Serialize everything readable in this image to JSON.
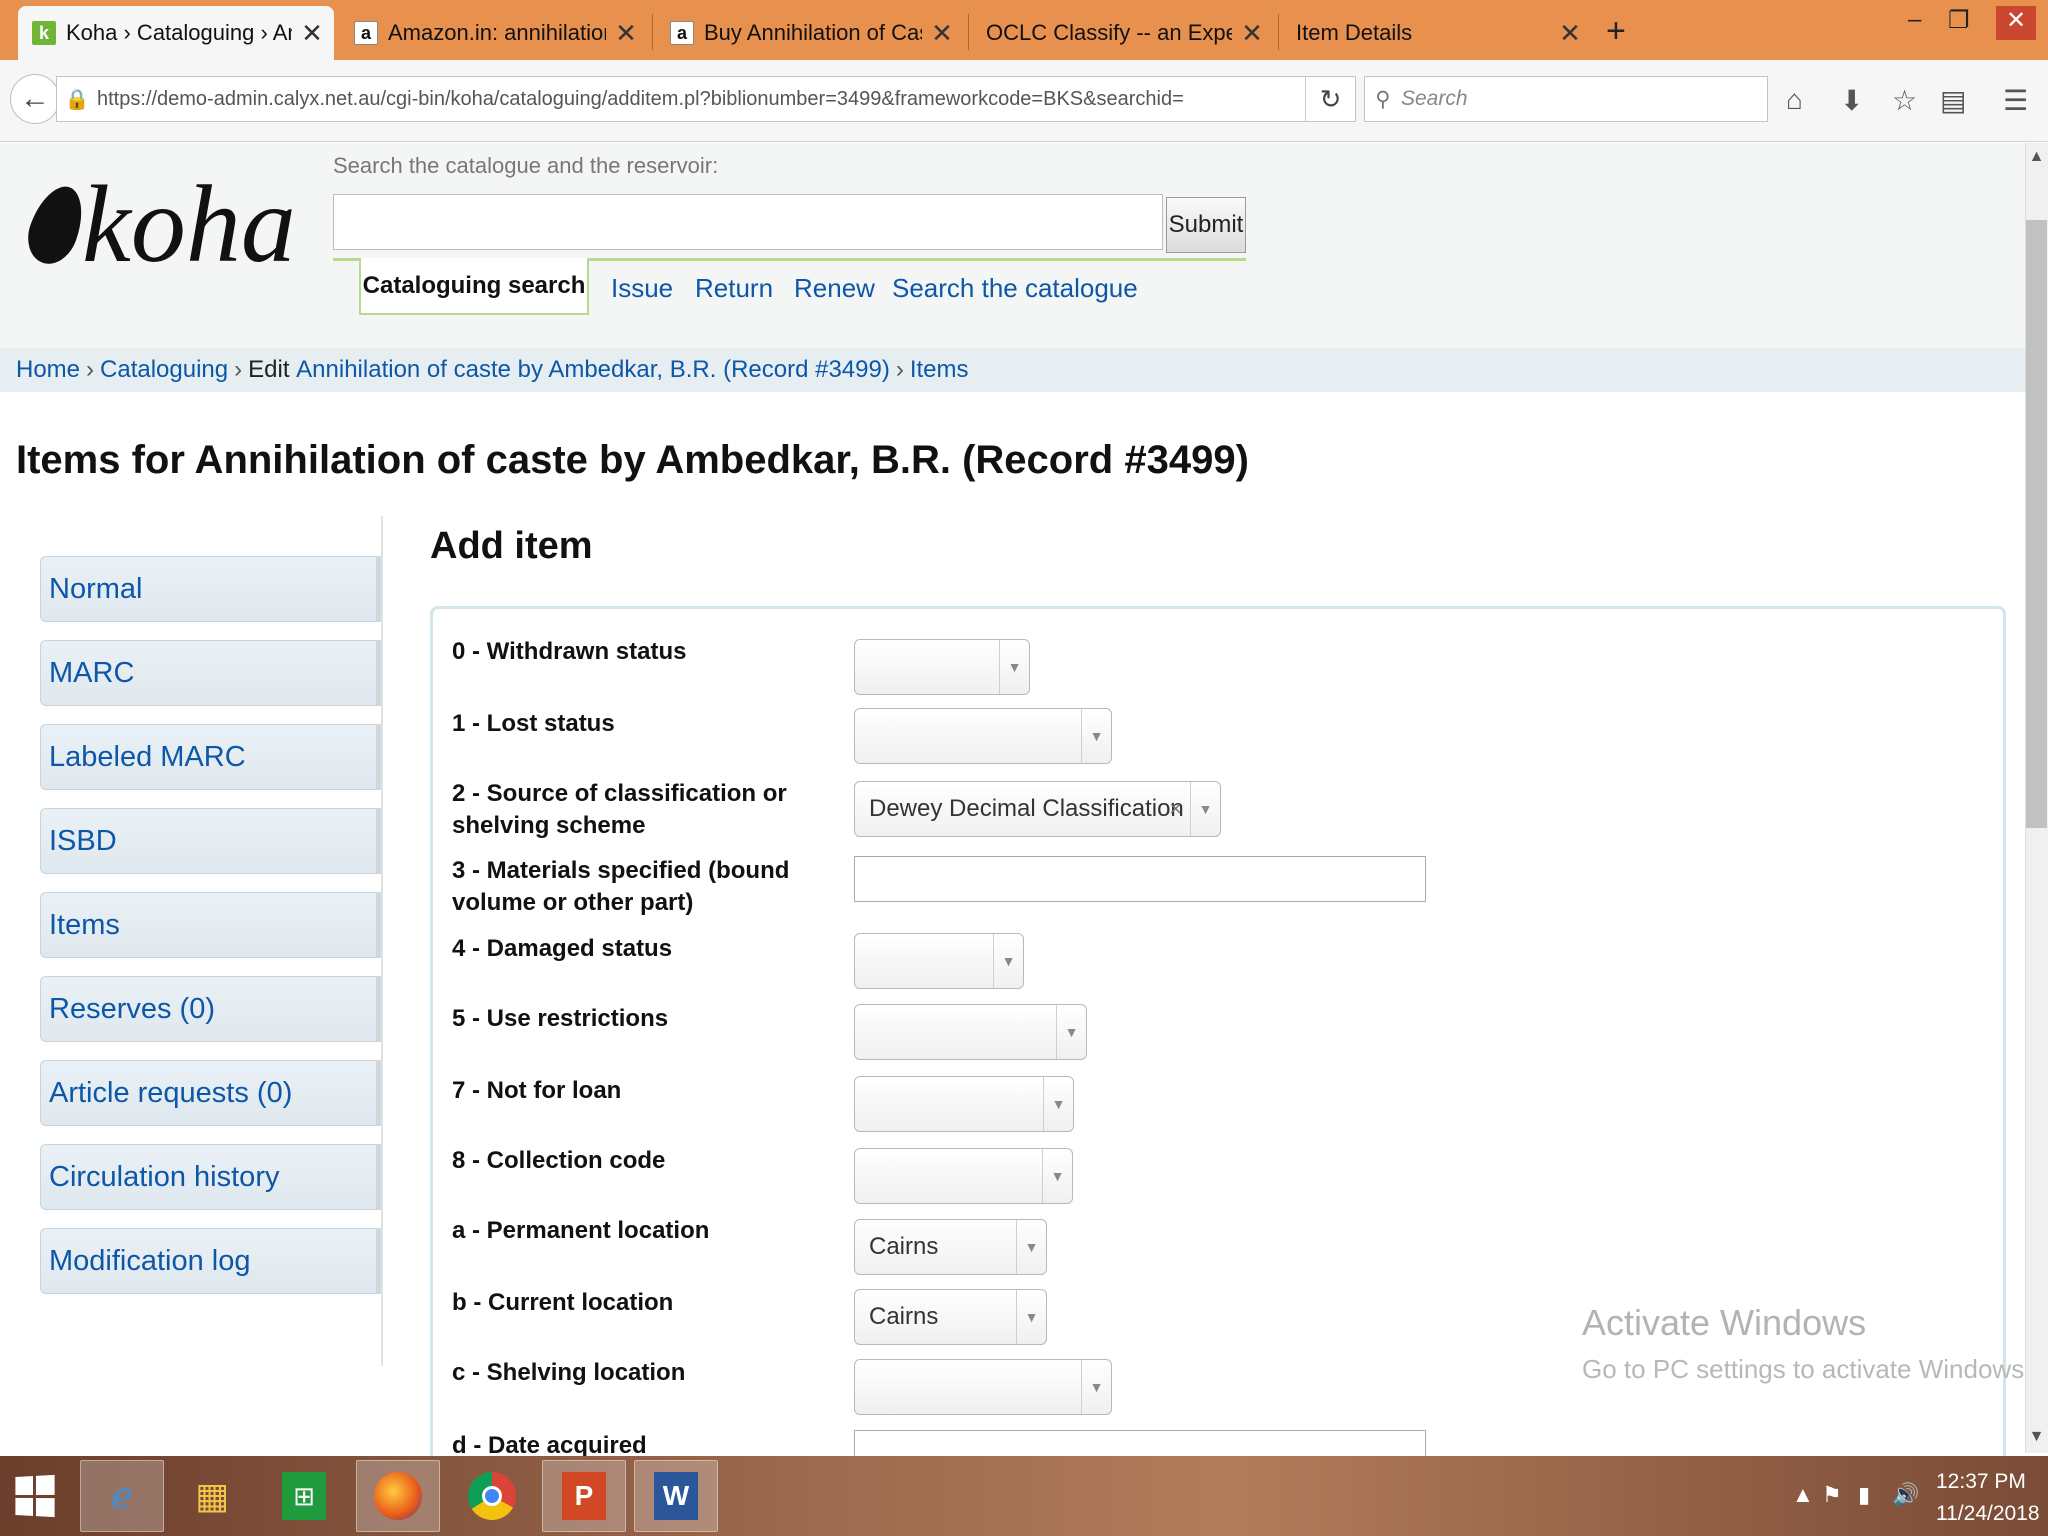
{
  "browser": {
    "tabs": [
      {
        "label": "Koha › Cataloguing › Anni...",
        "favicon": "koha-icon",
        "active": true
      },
      {
        "label": "Amazon.in: annihilation o...",
        "favicon": "amazon-icon"
      },
      {
        "label": "Buy Annihilation of Caste:...",
        "favicon": "amazon-icon"
      },
      {
        "label": "OCLC Classify -- an Experimen...",
        "favicon": ""
      },
      {
        "label": "Item Details",
        "favicon": ""
      }
    ],
    "url": "https://demo-admin.calyx.net.au/cgi-bin/koha/cataloguing/additem.pl?biblionumber=3499&frameworkcode=BKS&searchid=",
    "search_placeholder": "Search"
  },
  "header": {
    "logo_text": "koha",
    "search_label": "Search the catalogue and the reservoir:",
    "submit_label": "Submit",
    "active_tab": "Cataloguing search",
    "links": [
      "Issue",
      "Return",
      "Renew",
      "Search the catalogue"
    ]
  },
  "breadcrumb": {
    "home": "Home",
    "cataloguing": "Cataloguing",
    "edit_prefix": "Edit",
    "record": "Annihilation of caste by Ambedkar, B.R. (Record #3499)",
    "items": "Items",
    "sep": "›"
  },
  "page_title": "Items for Annihilation of caste by Ambedkar, B.R. (Record #3499)",
  "left_menu": [
    "Normal",
    "MARC",
    "Labeled MARC",
    "ISBD",
    "Items",
    "Reserves (0)",
    "Article requests (0)",
    "Circulation history",
    "Modification log"
  ],
  "add_item": {
    "heading": "Add item",
    "fields": [
      {
        "label": "0 - Withdrawn status",
        "value": ""
      },
      {
        "label": "1 - Lost status",
        "value": ""
      },
      {
        "label": "2 - Source of classification or shelving scheme",
        "value": "Dewey Decimal Classification"
      },
      {
        "label": "3 - Materials specified (bound volume or other part)",
        "value": ""
      },
      {
        "label": "4 - Damaged status",
        "value": ""
      },
      {
        "label": "5 - Use restrictions",
        "value": ""
      },
      {
        "label": "7 - Not for loan",
        "value": ""
      },
      {
        "label": "8 - Collection code",
        "value": ""
      },
      {
        "label": "a - Permanent location",
        "value": "Cairns"
      },
      {
        "label": "b - Current location",
        "value": "Cairns"
      },
      {
        "label": "c - Shelving location",
        "value": ""
      },
      {
        "label": "d - Date acquired",
        "value": ""
      }
    ]
  },
  "watermark": {
    "line1": "Activate Windows",
    "line2": "Go to PC settings to activate Windows."
  },
  "taskbar": {
    "apps": [
      "internet-explorer-icon",
      "file-explorer-icon",
      "store-icon",
      "firefox-icon",
      "chrome-icon",
      "powerpoint-icon",
      "word-icon"
    ],
    "time": "12:37 PM",
    "date": "11/24/2018"
  },
  "colors": {
    "tabbar": "#e8914f",
    "link": "#0d57a8",
    "header_bg": "#f4f6f6",
    "green_accent": "#b9d98d"
  }
}
